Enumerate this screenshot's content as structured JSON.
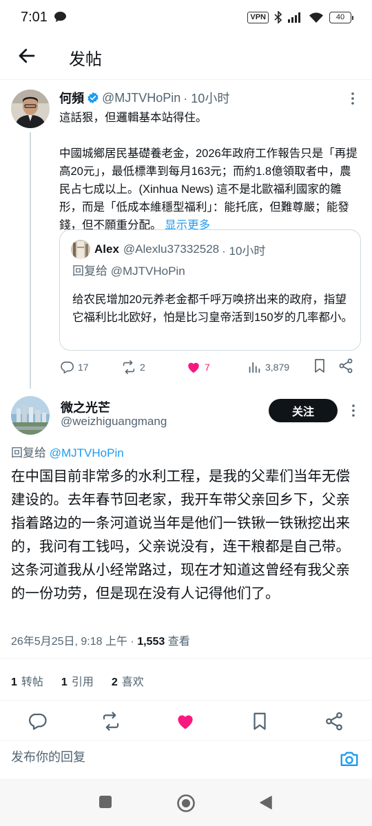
{
  "status_bar": {
    "time": "7:01",
    "vpn": "VPN",
    "battery": "40"
  },
  "header": {
    "title": "发帖"
  },
  "parent_tweet": {
    "name": "何頻",
    "handle": "@MJTVHoPin",
    "time": "· 10小时",
    "text": "這話狠，但邏輯基本站得住。\n\n中國城鄉居民基礎養老金，2026年政府工作報告只是「再提高20元」，最低標準到每月163元；而約1.8億領取者中，農民占七成以上。(Xinhua News) 這不是北歐福利國家的雛形，而是「低成本維穩型福利」：能托底，但難尊嚴；能發錢，但不願重分配。",
    "show_more": "显示更多",
    "quote": {
      "name": "Alex",
      "handle": "@Alexlu37332528",
      "time": "· 10小时",
      "replying_to": "回复给 @MJTVHoPin",
      "text": "给农民增加20元养老金都千呼万唤挤出来的政府，指望它福利比北欧好，怕是比习皇帝活到150岁的几率都小。"
    },
    "actions": {
      "replies": "17",
      "reposts": "2",
      "likes": "7",
      "views": "3,879"
    }
  },
  "main_tweet": {
    "name": "微之光芒",
    "handle": "@weizhiguangmang",
    "follow_label": "关注",
    "replying_prefix": "回复给 ",
    "replying_handle": "@MJTVHoPin",
    "text": "在中国目前非常多的水利工程，是我的父辈们当年无偿建设的。去年春节回老家，我开车带父亲回乡下，父亲指着路边的一条河道说当年是他们一铁锹一铁锹挖出来的，我问有工钱吗，父亲说没有，连干粮都是自己带。这条河道我从小经常路过，现在才知道这曾经有我父亲的一份功劳，但是现在没有人记得他们了。",
    "timestamp": "26年5月25日, 9:18 上午 · ",
    "views_count": "1,553",
    "views_label": " 查看",
    "stats": {
      "reposts_count": "1",
      "reposts_label": "转帖",
      "quotes_count": "1",
      "quotes_label": "引用",
      "likes_count": "2",
      "likes_label": "喜欢"
    }
  },
  "reply_bar": {
    "placeholder": "发布你的回复"
  },
  "colors": {
    "accent": "#1d9bf0",
    "like": "#f91880",
    "text": "#0f1419",
    "muted": "#536471"
  }
}
